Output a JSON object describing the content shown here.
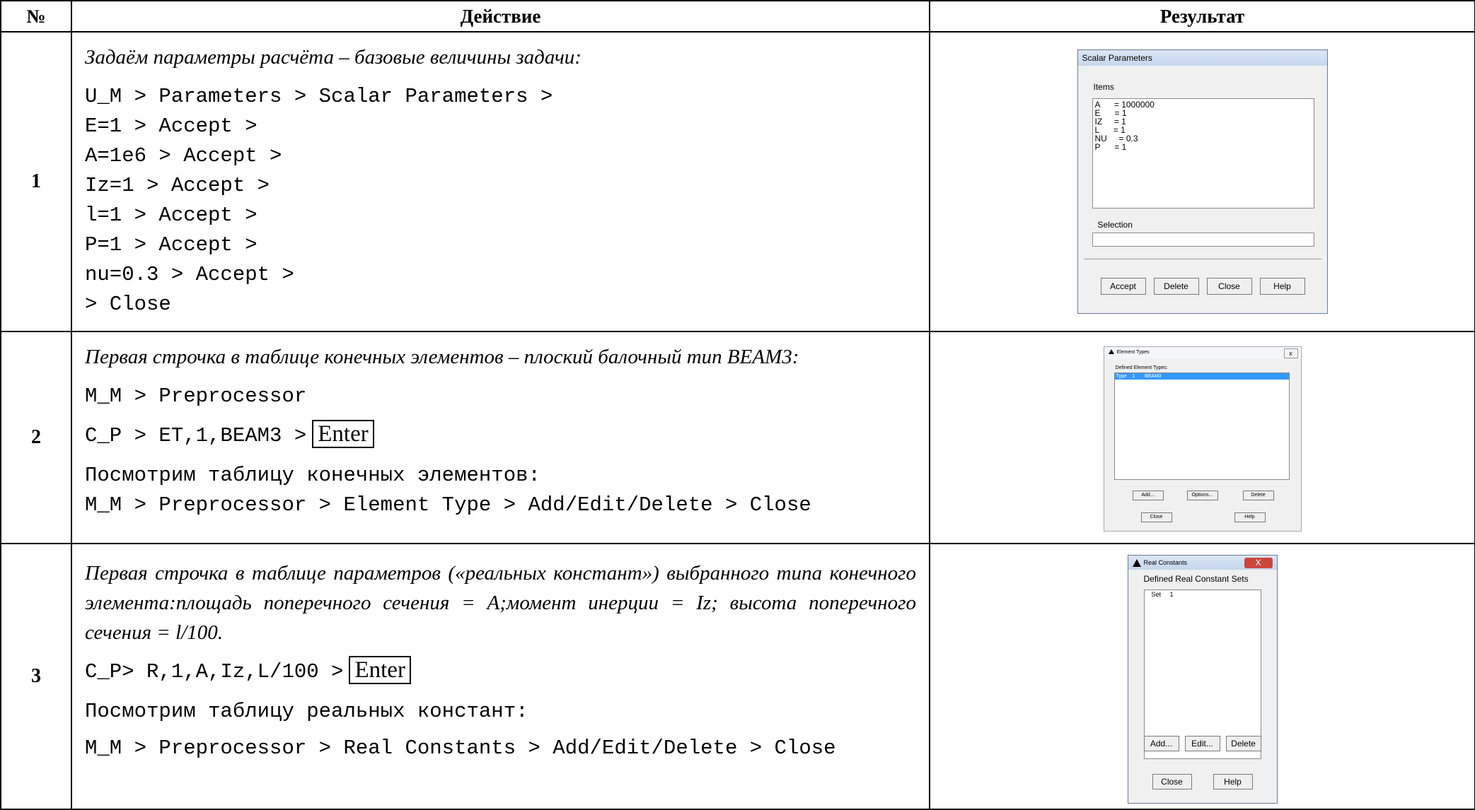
{
  "header": {
    "col_num": "№",
    "col_action": "Действие",
    "col_result": "Результат"
  },
  "rows": [
    {
      "num": "1",
      "intro": "Задаём параметры расчёта – базовые величины задачи:",
      "code": [
        "U_M > Parameters > Scalar Parameters >",
        "E=1 > Accept >",
        "A=1e6 > Accept >",
        "Iz=1 > Accept >",
        "l=1 > Accept >",
        "P=1 > Accept >",
        "nu=0.3 > Accept >",
        "> Close"
      ]
    },
    {
      "num": "2",
      "intro": "Первая строчка в таблице конечных элементов – плоский балочный тип BEAM3:",
      "code1": "M_M > Preprocessor",
      "code2": "C_P > ET,1,BEAM3 >",
      "enter": "Enter",
      "sub": "Посмотрим таблицу конечных элементов:",
      "code3": "M_M > Preprocessor > Element Type > Add/Edit/Delete > Close"
    },
    {
      "num": "3",
      "intro": "Первая строчка в таблице параметров («реальных констант») выбранного типа конечного элемента:площадь поперечного сечения = A;момент инерции = Iz; высота поперечного сечения = l/100.",
      "code1": "C_P> R,1,A,Iz,L/100 >",
      "enter": "Enter",
      "sub": "Посмотрим таблицу реальных констант:",
      "code2": "M_M > Preprocessor > Real Constants > Add/Edit/Delete > Close"
    }
  ],
  "dialog1": {
    "title": "Scalar Parameters",
    "items_label": "Items",
    "items": [
      "A      = 1000000",
      "E      = 1",
      "IZ     = 1",
      "L      = 1",
      "NU     = 0.3",
      "P      = 1"
    ],
    "selection_label": "Selection",
    "buttons": [
      "Accept",
      "Delete",
      "Close",
      "Help"
    ]
  },
  "dialog2": {
    "title": "Element Types",
    "close": "x",
    "defined_label": "Defined Element Types:",
    "selected_item": "Type    1       BEAM3",
    "buttons": [
      "Add...",
      "Options...",
      "Delete",
      "Close",
      "Help"
    ]
  },
  "dialog3": {
    "title": "Real Constants",
    "close": "X",
    "defined_label": "Defined Real Constant Sets",
    "list_item": "Set     1",
    "buttons": [
      "Add...",
      "Edit...",
      "Delete",
      "Close",
      "Help"
    ]
  }
}
